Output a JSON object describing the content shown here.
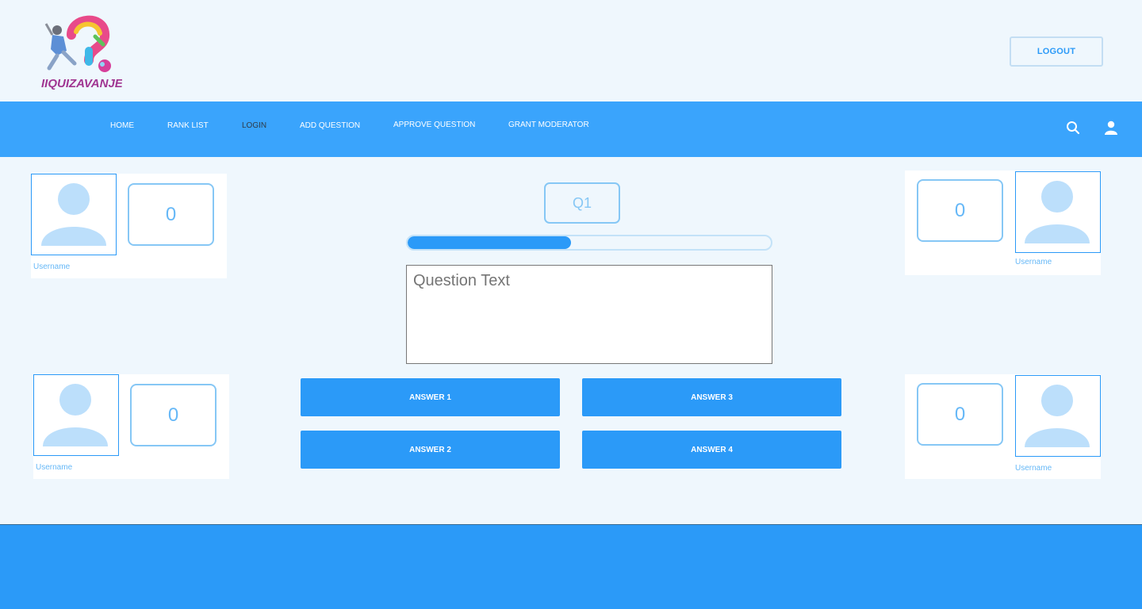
{
  "header": {
    "logo_text": "IIQUIZAVANJE",
    "logout_label": "LOGOUT"
  },
  "nav": {
    "items": [
      {
        "label": "HOME"
      },
      {
        "label": "RANK LIST"
      },
      {
        "label": "LOGIN"
      },
      {
        "label": "ADD QUESTION"
      },
      {
        "label": "APPROVE QUESTION"
      },
      {
        "label": "GRANT MODERATOR"
      }
    ],
    "active_index": 2,
    "icons": [
      "search-icon",
      "user-icon"
    ]
  },
  "players": [
    {
      "username": "Username",
      "score": "0"
    },
    {
      "username": "Username",
      "score": "0"
    },
    {
      "username": "Username",
      "score": "0"
    },
    {
      "username": "Username",
      "score": "0"
    }
  ],
  "question": {
    "number_label": "Q1",
    "progress_fraction": 0.45,
    "placeholder_text": "Question Text"
  },
  "answers": [
    {
      "label": "ANSWER 1"
    },
    {
      "label": "ANSWER 2"
    },
    {
      "label": "ANSWER 3"
    },
    {
      "label": "ANSWER 4"
    }
  ],
  "colors": {
    "accent": "#2b9af8",
    "nav": "#3aa4fc",
    "background": "#eff7fd",
    "avatar": "#bcdffb"
  }
}
